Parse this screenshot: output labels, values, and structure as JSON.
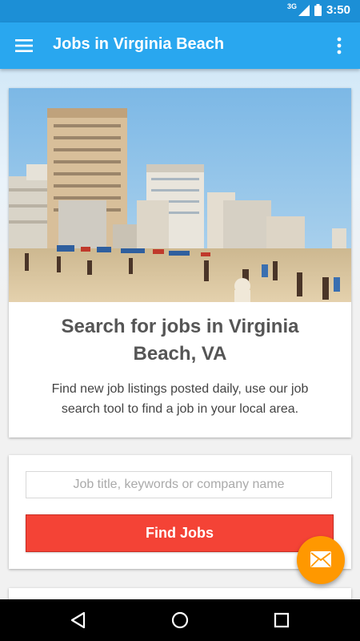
{
  "status_bar": {
    "network": "3G",
    "time": "3:50"
  },
  "app_bar": {
    "title": "Jobs in Virginia Beach",
    "menu_icon": "hamburger-menu-icon",
    "overflow_icon": "more-vert-icon"
  },
  "hero": {
    "title": "Search for jobs in Virginia Beach, VA",
    "description": "Find new job listings posted daily, use our job search tool to find a job in your local area."
  },
  "search": {
    "placeholder": "Job title, keywords or company name",
    "value": "",
    "button_label": "Find Jobs"
  },
  "fab": {
    "icon": "mail-icon"
  },
  "nav": {
    "back_icon": "back-triangle-icon",
    "home_icon": "home-circle-icon",
    "recents_icon": "recents-square-icon"
  },
  "colors": {
    "status_bar": "#1c8fd6",
    "app_bar": "#29a7ef",
    "find_button": "#f44336",
    "fab": "#ff9800"
  }
}
